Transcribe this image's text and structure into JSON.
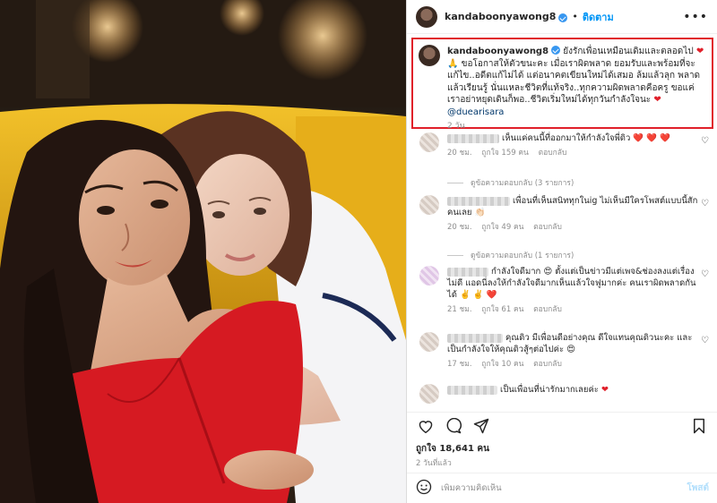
{
  "header": {
    "username": "kandaboonyawong8",
    "separator": "•",
    "follow_label": "ติดตาม",
    "more_icon": "more-horizontal-icon"
  },
  "caption": {
    "username": "kandaboonyawong8",
    "text": "ยังรักเพื่อนเหมือนเดิมและตลอดไป",
    "text2": "ขอโอกาสให้ตัวขนะคะ เมื่อเราผิดพลาด ยอมรับและพร้อมที่จะแก้ไข..อดีตแก้ไม่ได้ แต่อนาคตเขียนใหม่ได้เสมอ ล้มแล้วลุก พลาดแล้วเรียนรู้ นั่นแหละชีวิตที่แท้จริง..ทุกความผิดพลาดคือครู ขอแค่เราอย่าหยุดเดินก็พอ..ชีวิตเริ่มใหม่ได้ทุกวันกำลังใจนะ",
    "mention": "@duearisara",
    "time": "2 วัน",
    "heart_color": "#e0202a"
  },
  "comments": [
    {
      "text": "เห็นแค่คนนี้ที่ออกมาให้กำลังใจพี่ดิว",
      "emoji": "❤️ ❤️ ❤️",
      "time": "20 ชม.",
      "likes": "ถูกใจ 159 คน",
      "reply": "ตอบกลับ",
      "replies": "ดูข้อความตอบกลับ (3 รายการ)"
    },
    {
      "text": "เพื่อนที่เห็นสนิททุกในig ไม่เห็นมีใครโพสต์แบบนี้สักคนเลย",
      "emoji": "👏🏻",
      "time": "20 ชม.",
      "likes": "ถูกใจ 49 คน",
      "reply": "ตอบกลับ",
      "replies": "ดูข้อความตอบกลับ (1 รายการ)"
    },
    {
      "text": "กำลังใจดีมาก",
      "text2": "ตั้งแต่เป็นข่าวมีแต่เพจ&ช่องลงแต่เรื่องไม่ดี แอดนี่ลงให้กำลังใจดีมากเห็นแล้วใจฟูมากค่ะ คนเราผิดพลาดกันได้",
      "emoji": "✌️ ✌️ ❤️",
      "time": "21 ชม.",
      "likes": "ถูกใจ 61 คน",
      "reply": "ตอบกลับ"
    },
    {
      "text": "คุณดิว มีเพื่อนดีอย่างคุณ ดีใจแทนคุณดิวนะคะ และเป็นกำลังใจให้คุณดิวสู้ๆต่อไปค่ะ",
      "time": "17 ชม.",
      "likes": "ถูกใจ 10 คน",
      "reply": "ตอบกลับ"
    },
    {
      "text": "เป็นเพื่อนที่น่ารักมากเลยค่ะ"
    }
  ],
  "actions": {
    "like_icon": "heart-outline-icon",
    "comment_icon": "comment-icon",
    "share_icon": "send-icon",
    "save_icon": "bookmark-icon"
  },
  "likes": "ถูกใจ 18,641 คน",
  "posted_ago": "2 วันที่แล้ว",
  "add_comment": {
    "placeholder": "เพิ่มความคิดเห็น",
    "post_label": "โพสต์",
    "emoji_icon": "smiley-icon"
  }
}
